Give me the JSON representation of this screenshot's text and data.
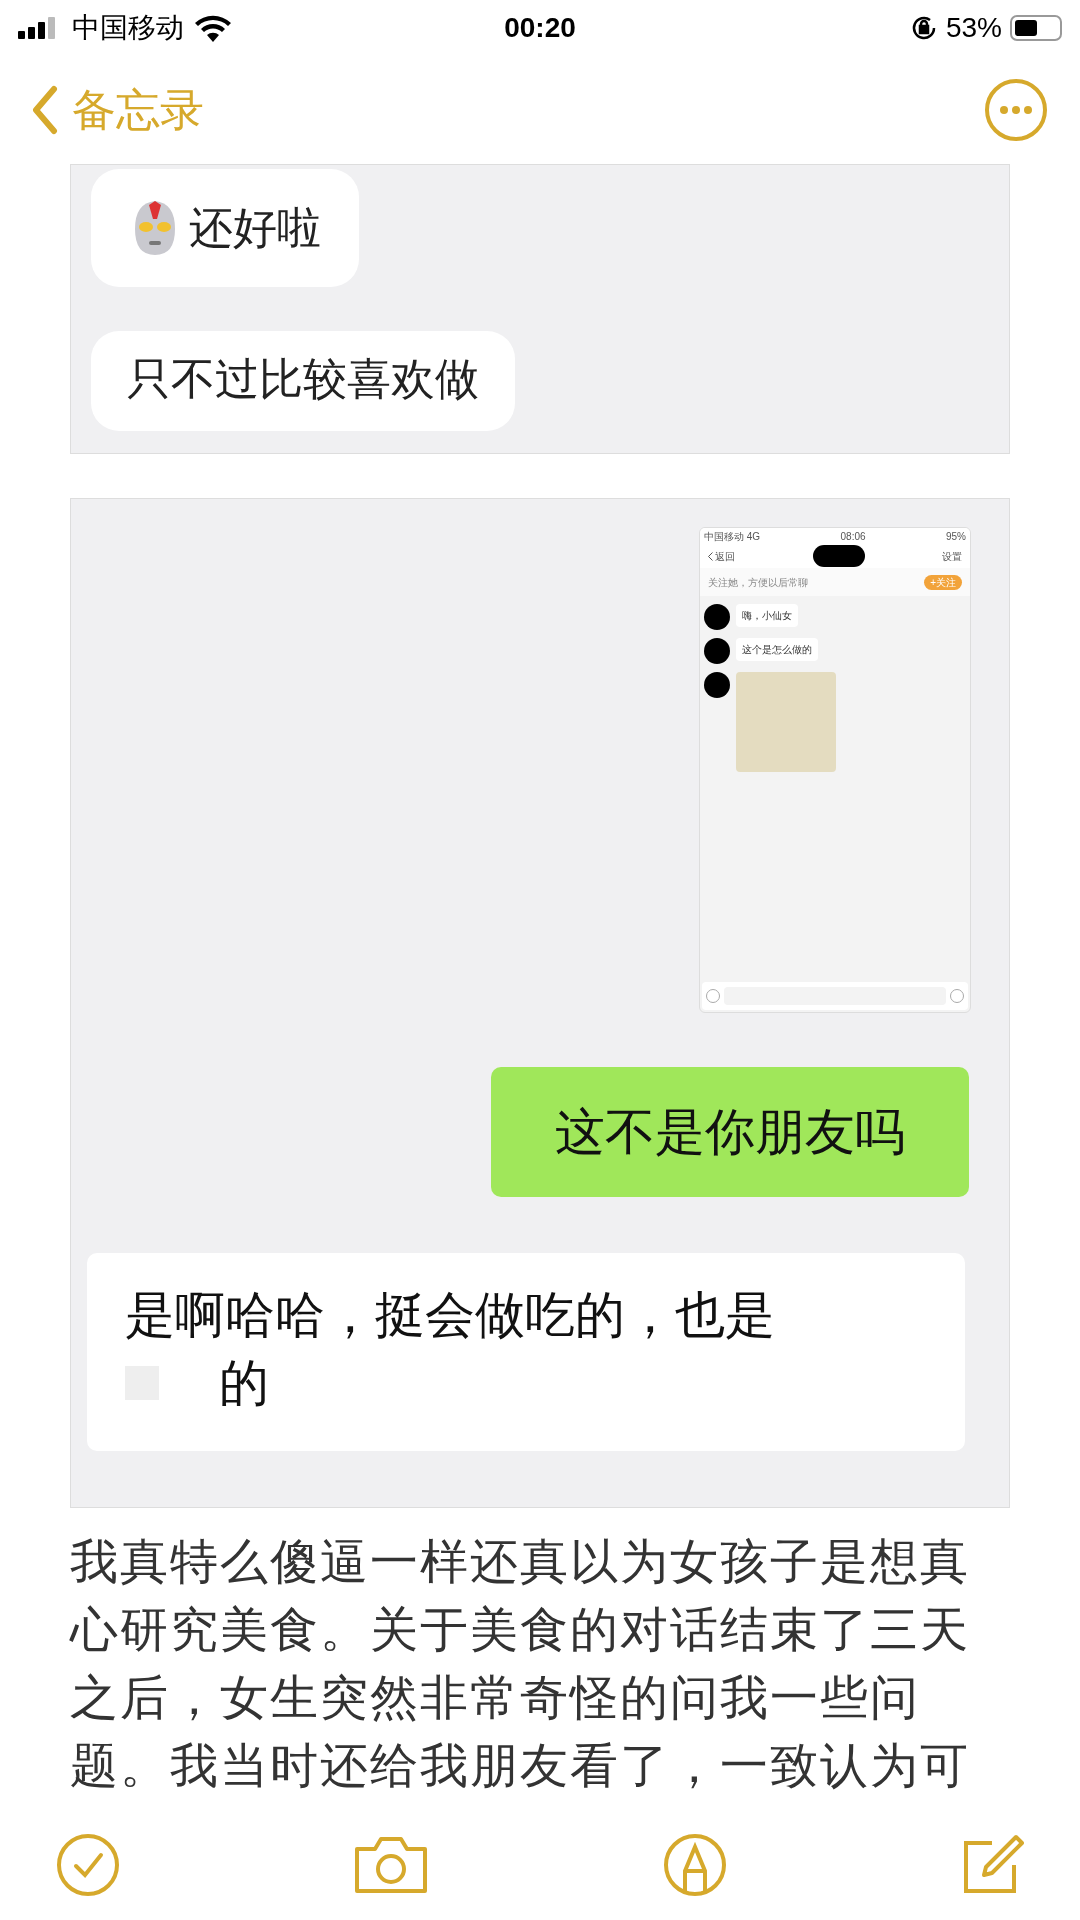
{
  "status_bar": {
    "carrier": "中国移动",
    "time": "00:20",
    "battery": "53%"
  },
  "nav": {
    "back_label": "备忘录"
  },
  "card_1": {
    "messages": [
      {
        "kind": "emoji",
        "text": "还好啦"
      },
      {
        "kind": "plain",
        "text": "只不过比较喜欢做"
      }
    ]
  },
  "card_2": {
    "embedded_screen": {
      "carrier": "中国移动  4G",
      "time": "08:06",
      "battery": "95%",
      "back": "返回",
      "settings": "设置",
      "follow_hint": "关注她，方便以后常聊",
      "follow_button": "+关注",
      "messages": [
        {
          "kind": "text",
          "text": "嗨，小仙女"
        },
        {
          "kind": "text",
          "text": "这个是怎么做的"
        },
        {
          "kind": "photo"
        }
      ]
    },
    "sent": "这不是你朋友吗",
    "reply_line_1": "是啊哈哈，挺会做吃的，也是",
    "reply_line_2": "的"
  },
  "body": "我真特么傻逼一样还真以为女孩子是想真心研究美食。关于美食的对话结束了三天之后，女生突然非常奇怪的问我一些问题。我当时还给我朋友看了，一致认为可"
}
